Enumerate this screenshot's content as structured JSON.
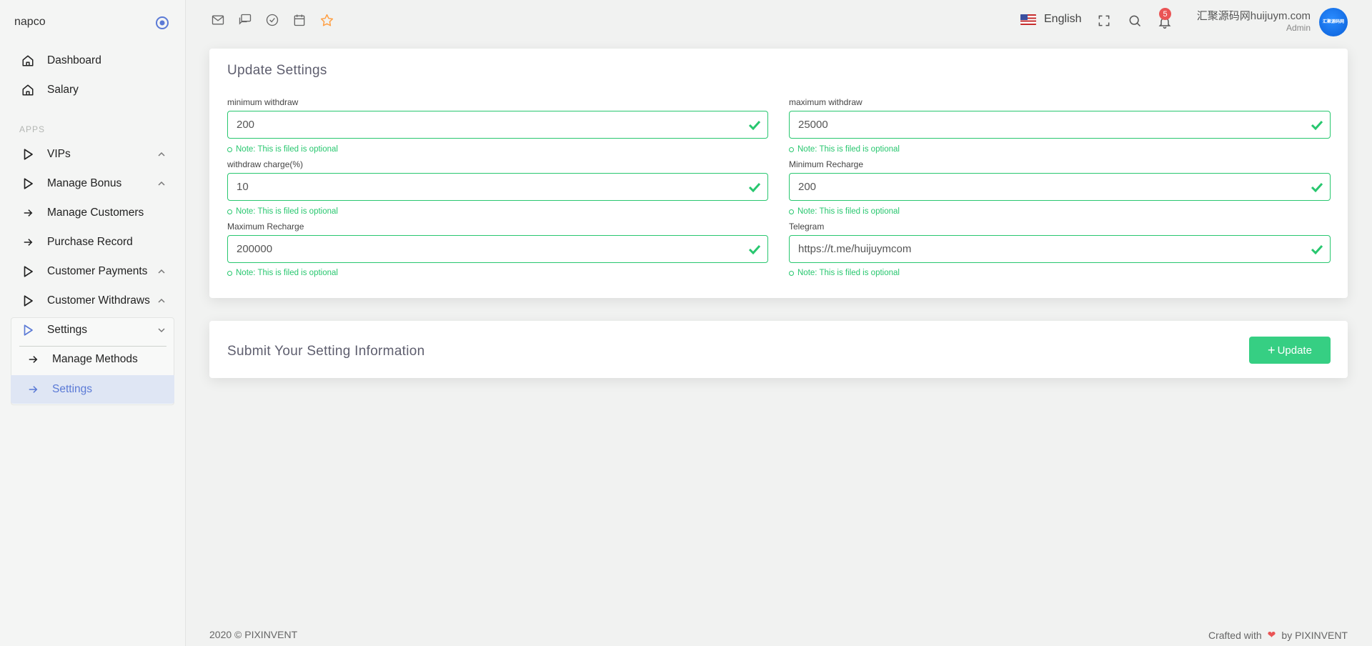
{
  "sidebar": {
    "brand": "napco",
    "section_apps": "APPS",
    "items": [
      {
        "label": "Dashboard"
      },
      {
        "label": "Salary"
      },
      {
        "label": "VIPs"
      },
      {
        "label": "Manage Bonus"
      },
      {
        "label": "Manage Customers"
      },
      {
        "label": "Purchase Record"
      },
      {
        "label": "Customer Payments"
      },
      {
        "label": "Customer Withdraws"
      },
      {
        "label": "Settings"
      }
    ],
    "sub_items": [
      {
        "label": "Manage Methods"
      },
      {
        "label": "Settings"
      }
    ]
  },
  "topbar": {
    "language": "English",
    "notification_count": "5",
    "user_name": "汇聚源码网huijuym.com",
    "user_role": "Admin",
    "avatar_text": "汇聚源码网"
  },
  "settings_card": {
    "title": "Update Settings",
    "fields": [
      {
        "label": "minimum withdraw",
        "value": "200",
        "note": "Note: This is filed is optional"
      },
      {
        "label": "maximum withdraw",
        "value": "25000",
        "note": "Note: This is filed is optional"
      },
      {
        "label": "withdraw charge(%)",
        "value": "10",
        "note": "Note: This is filed is optional"
      },
      {
        "label": "Minimum Recharge",
        "value": "200",
        "note": "Note: This is filed is optional"
      },
      {
        "label": "Maximum Recharge",
        "value": "200000",
        "note": "Note: This is filed is optional"
      },
      {
        "label": "Telegram",
        "value": "https://t.me/huijuymcom",
        "note": "Note: This is filed is optional"
      }
    ]
  },
  "submit_card": {
    "title": "Submit Your Setting Information",
    "button_label": "Update"
  },
  "footer": {
    "copyright": "2020 © PIXINVENT",
    "crafted_prefix": "Crafted with",
    "crafted_suffix": "by PIXINVENT"
  },
  "colors": {
    "accent_green": "#28c76f",
    "active_blue": "#5b7ad6",
    "badge_red": "#ea5455"
  },
  "icons": {
    "topbar": [
      "mail-icon",
      "chat-icon",
      "check-circle-icon",
      "calendar-icon",
      "star-icon"
    ],
    "right": [
      "fullscreen-icon",
      "search-icon",
      "bell-icon"
    ]
  }
}
